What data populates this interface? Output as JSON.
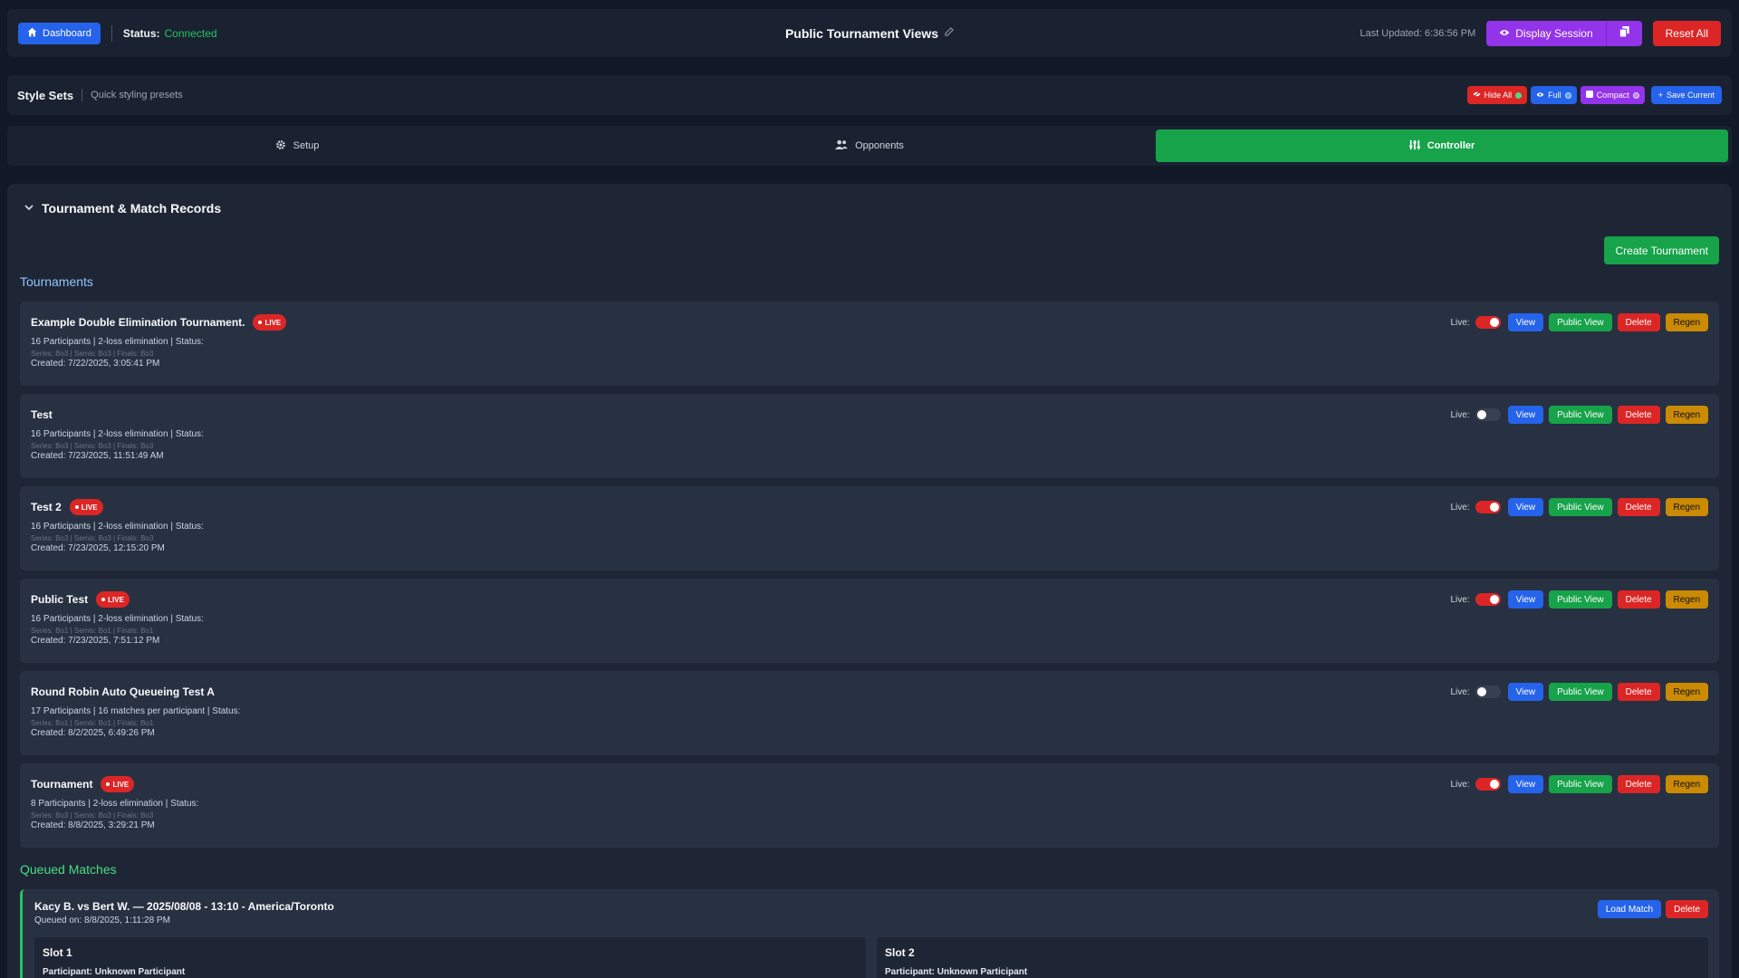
{
  "header": {
    "dashboard_label": "Dashboard",
    "status_label": "Status:",
    "status_value": "Connected",
    "title": "Public Tournament Views",
    "last_updated": "Last Updated: 6:36:56 PM",
    "display_session_label": "Display Session",
    "reset_all_label": "Reset All"
  },
  "style_sets": {
    "title": "Style Sets",
    "subtitle": "Quick styling presets",
    "buttons": {
      "hide_all": "Hide All",
      "full": "Full",
      "compact": "Compact",
      "save_current": "Save Current"
    }
  },
  "tabs": [
    "Setup",
    "Opponents",
    "Controller"
  ],
  "panel": {
    "title": "Tournament & Match Records",
    "create_label": "Create Tournament",
    "tournaments_heading": "Tournaments",
    "queued_heading": "Queued Matches"
  },
  "actions": {
    "live": "Live:",
    "view": "View",
    "public_view": "Public View",
    "delete": "Delete",
    "regen": "Regen",
    "load_match": "Load Match",
    "live_badge": "LIVE"
  },
  "tournaments": [
    {
      "name": "Example Double Elimination Tournament.",
      "live": true,
      "meta": "16 Participants | 2-loss elimination | Status:",
      "series": "Series: Bo3 | Semis: Bo3 | Finals: Bo3",
      "created": "Created: 7/22/2025, 3:05:41 PM"
    },
    {
      "name": "Test",
      "live": false,
      "meta": "16 Participants | 2-loss elimination | Status:",
      "series": "Series: Bo3 | Semis: Bo3 | Finals: Bo3",
      "created": "Created: 7/23/2025, 11:51:49 AM"
    },
    {
      "name": "Test 2",
      "live": true,
      "meta": "16 Participants | 2-loss elimination | Status:",
      "series": "Series: Bo3 | Semis: Bo3 | Finals: Bo3",
      "created": "Created: 7/23/2025, 12:15:20 PM"
    },
    {
      "name": "Public Test",
      "live": true,
      "meta": "16 Participants | 2-loss elimination | Status:",
      "series": "Series: Bo1 | Semis: Bo1 | Finals: Bo1",
      "created": "Created: 7/23/2025, 7:51:12 PM"
    },
    {
      "name": "Round Robin Auto Queueing Test A",
      "live": false,
      "meta": "17 Participants | 16 matches per participant | Status:",
      "series": "Series: Bo1 | Semis: Bo1 | Finals: Bo1",
      "created": "Created: 8/2/2025, 6:49:26 PM"
    },
    {
      "name": "Tournament",
      "live": true,
      "meta": "8 Participants | 2-loss elimination | Status:",
      "series": "Series: Bo3 | Semis: Bo3 | Finals: Bo3",
      "created": "Created: 8/8/2025, 3:29:21 PM"
    }
  ],
  "queued": {
    "title": "Kacy B. vs Bert W. — 2025/08/08 - 13:10 - America/Toronto",
    "queued_on": "Queued on: 8/8/2025, 1:11:28 PM",
    "slots": [
      {
        "title": "Slot 1",
        "participant": "Participant: Unknown Participant"
      },
      {
        "title": "Slot 2",
        "participant": "Participant: Unknown Participant"
      }
    ]
  }
}
